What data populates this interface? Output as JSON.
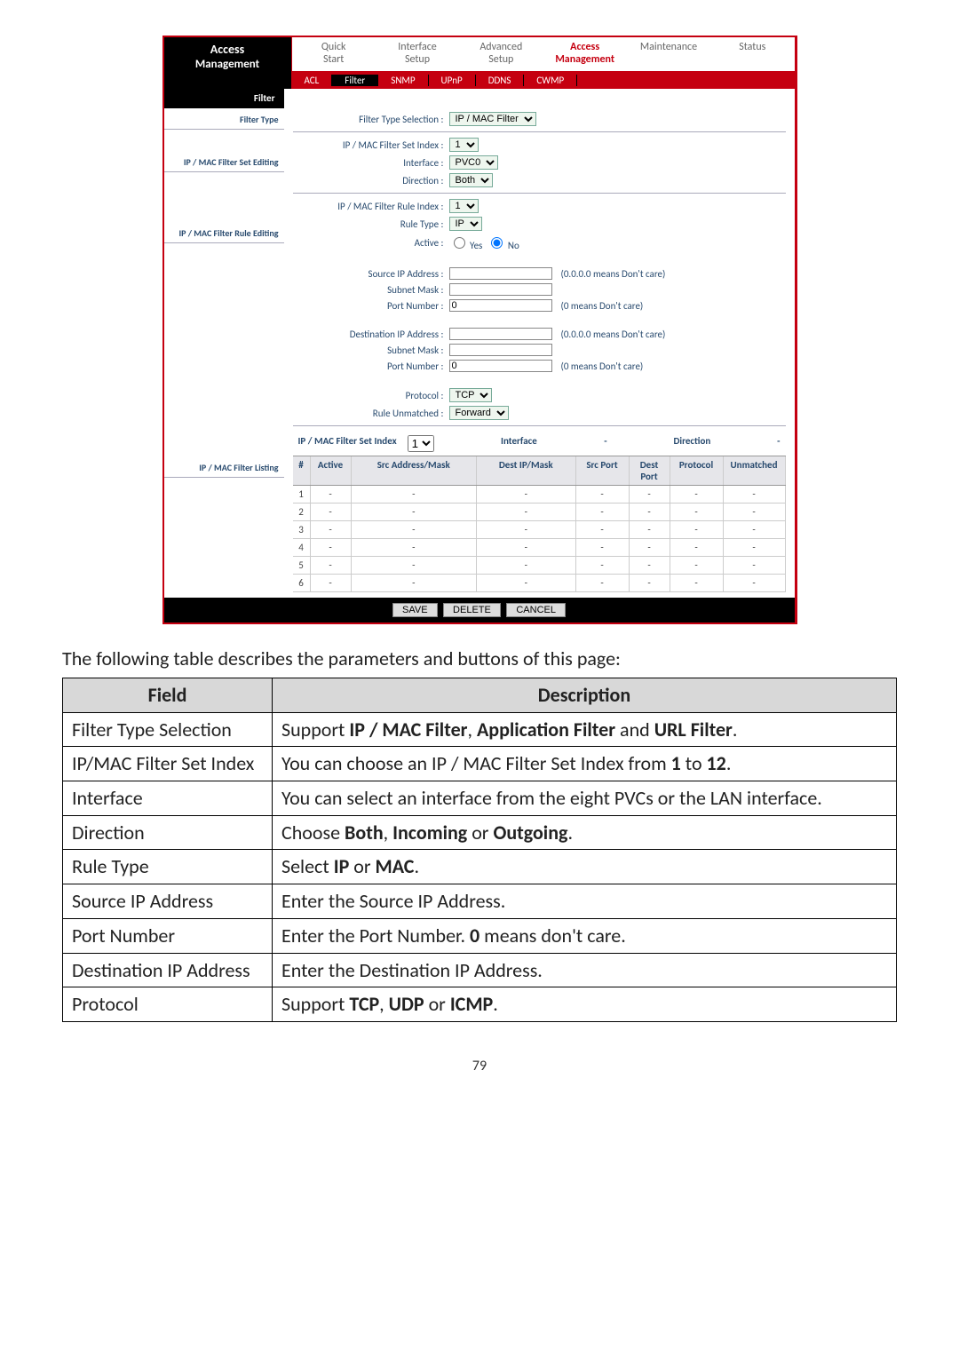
{
  "router": {
    "brand1": "Access",
    "brand2": "Management",
    "mainnav": [
      "Quick\nStart",
      "Interface\nSetup",
      "Advanced\nSetup",
      "Access\nManagement",
      "Maintenance",
      "Status"
    ],
    "mainnav_active": 3,
    "subnav": [
      "ACL",
      "Filter",
      "SNMP",
      "UPnP",
      "DDNS",
      "CWMP"
    ],
    "subnav_active": 1,
    "side_filter": "Filter",
    "side_filter_type": "Filter Type",
    "filter_type_sel_lbl": "Filter Type Selection :",
    "filter_type_sel_val": "IP / MAC Filter",
    "side_set": "IP / MAC Filter Set Editing",
    "set_index_lbl": "IP / MAC Filter Set Index :",
    "set_index_val": "1",
    "iface_lbl": "Interface :",
    "iface_val": "PVC0",
    "dir_lbl": "Direction :",
    "dir_val": "Both",
    "side_rule": "IP / MAC Filter Rule Editing",
    "rule_index_lbl": "IP / MAC Filter Rule Index :",
    "rule_index_val": "1",
    "rule_type_lbl": "Rule Type :",
    "rule_type_val": "IP",
    "active_lbl": "Active :",
    "active_yes": "Yes",
    "active_no": "No",
    "src_ip_lbl": "Source IP Address :",
    "src_ip_hint": "(0.0.0.0 means Don't care)",
    "src_mask_lbl": "Subnet Mask :",
    "src_port_lbl": "Port Number :",
    "src_port_val": "0",
    "port_hint": "(0 means Don't care)",
    "dst_ip_lbl": "Destination IP Address :",
    "dst_ip_hint": "(0.0.0.0 means Don't care)",
    "dst_mask_lbl": "Subnet Mask :",
    "dst_port_lbl": "Port Number :",
    "dst_port_val": "0",
    "proto_lbl": "Protocol :",
    "proto_val": "TCP",
    "unmatched_lbl": "Rule Unmatched :",
    "unmatched_val": "Forward",
    "side_list": "IP / MAC Filter Listing",
    "list_title_set": "IP / MAC Filter Set Index",
    "list_title_set_val": "1",
    "list_title_if": "Interface",
    "list_title_if_val": "-",
    "list_title_dir": "Direction",
    "list_title_dir_val": "-",
    "cols": {
      "n": "#",
      "a": "Active",
      "s": "Src Address/Mask",
      "d": "Dest IP/Mask",
      "sp": "Src Port",
      "dp": "Dest\nPort",
      "pr": "Protocol",
      "u": "Unmatched"
    },
    "rows": [
      {
        "n": "1",
        "a": "-",
        "s": "-",
        "d": "-",
        "sp": "-",
        "dp": "-",
        "pr": "-",
        "u": "-"
      },
      {
        "n": "2",
        "a": "-",
        "s": "-",
        "d": "-",
        "sp": "-",
        "dp": "-",
        "pr": "-",
        "u": "-"
      },
      {
        "n": "3",
        "a": "-",
        "s": "-",
        "d": "-",
        "sp": "-",
        "dp": "-",
        "pr": "-",
        "u": "-"
      },
      {
        "n": "4",
        "a": "-",
        "s": "-",
        "d": "-",
        "sp": "-",
        "dp": "-",
        "pr": "-",
        "u": "-"
      },
      {
        "n": "5",
        "a": "-",
        "s": "-",
        "d": "-",
        "sp": "-",
        "dp": "-",
        "pr": "-",
        "u": "-"
      },
      {
        "n": "6",
        "a": "-",
        "s": "-",
        "d": "-",
        "sp": "-",
        "dp": "-",
        "pr": "-",
        "u": "-"
      }
    ],
    "btn_save": "SAVE",
    "btn_delete": "DELETE",
    "btn_cancel": "CANCEL"
  },
  "caption": "The following table describes the parameters and buttons of this page:",
  "table": {
    "h1": "Field",
    "h2": "Description",
    "rows": [
      {
        "f": "Filter Type Selection",
        "d_pre": "Support ",
        "d_b": "IP / MAC Filter",
        "d_mid": ", ",
        "d_b2": "Application Filter",
        "d_mid2": " and ",
        "d_b3": "URL Filter",
        "d_post": "."
      },
      {
        "f": "IP/MAC Filter Set Index",
        "d_pre": "You can choose an IP / MAC Filter Set Index from ",
        "d_b": "1",
        "d_mid": " to ",
        "d_b2": "12",
        "d_post": "."
      },
      {
        "f": "Interface",
        "d_pre": "You can select an interface from the eight PVCs or the LAN interface."
      },
      {
        "f": "Direction",
        "d_pre": "Choose ",
        "d_b": "Both",
        "d_mid": ", ",
        "d_b2": "Incoming",
        "d_mid2": " or ",
        "d_b3": "Outgoing",
        "d_post": "."
      },
      {
        "f": "Rule Type",
        "d_pre": "Select ",
        "d_b": "IP",
        "d_mid": " or ",
        "d_b2": "MAC",
        "d_post": "."
      },
      {
        "f": "Source IP Address",
        "d_pre": "Enter the Source IP Address."
      },
      {
        "f": "Port Number",
        "d_pre": "Enter the Port Number. ",
        "d_b": "0",
        "d_post": " means don't care."
      },
      {
        "f": "Destination IP Address",
        "d_pre": "Enter the Destination IP Address."
      },
      {
        "f": "Protocol",
        "d_pre": "Support ",
        "d_b": "TCP",
        "d_mid": ", ",
        "d_b2": "UDP",
        "d_mid2": " or ",
        "d_b3": "ICMP",
        "d_post": "."
      }
    ]
  },
  "pagenum": "79"
}
